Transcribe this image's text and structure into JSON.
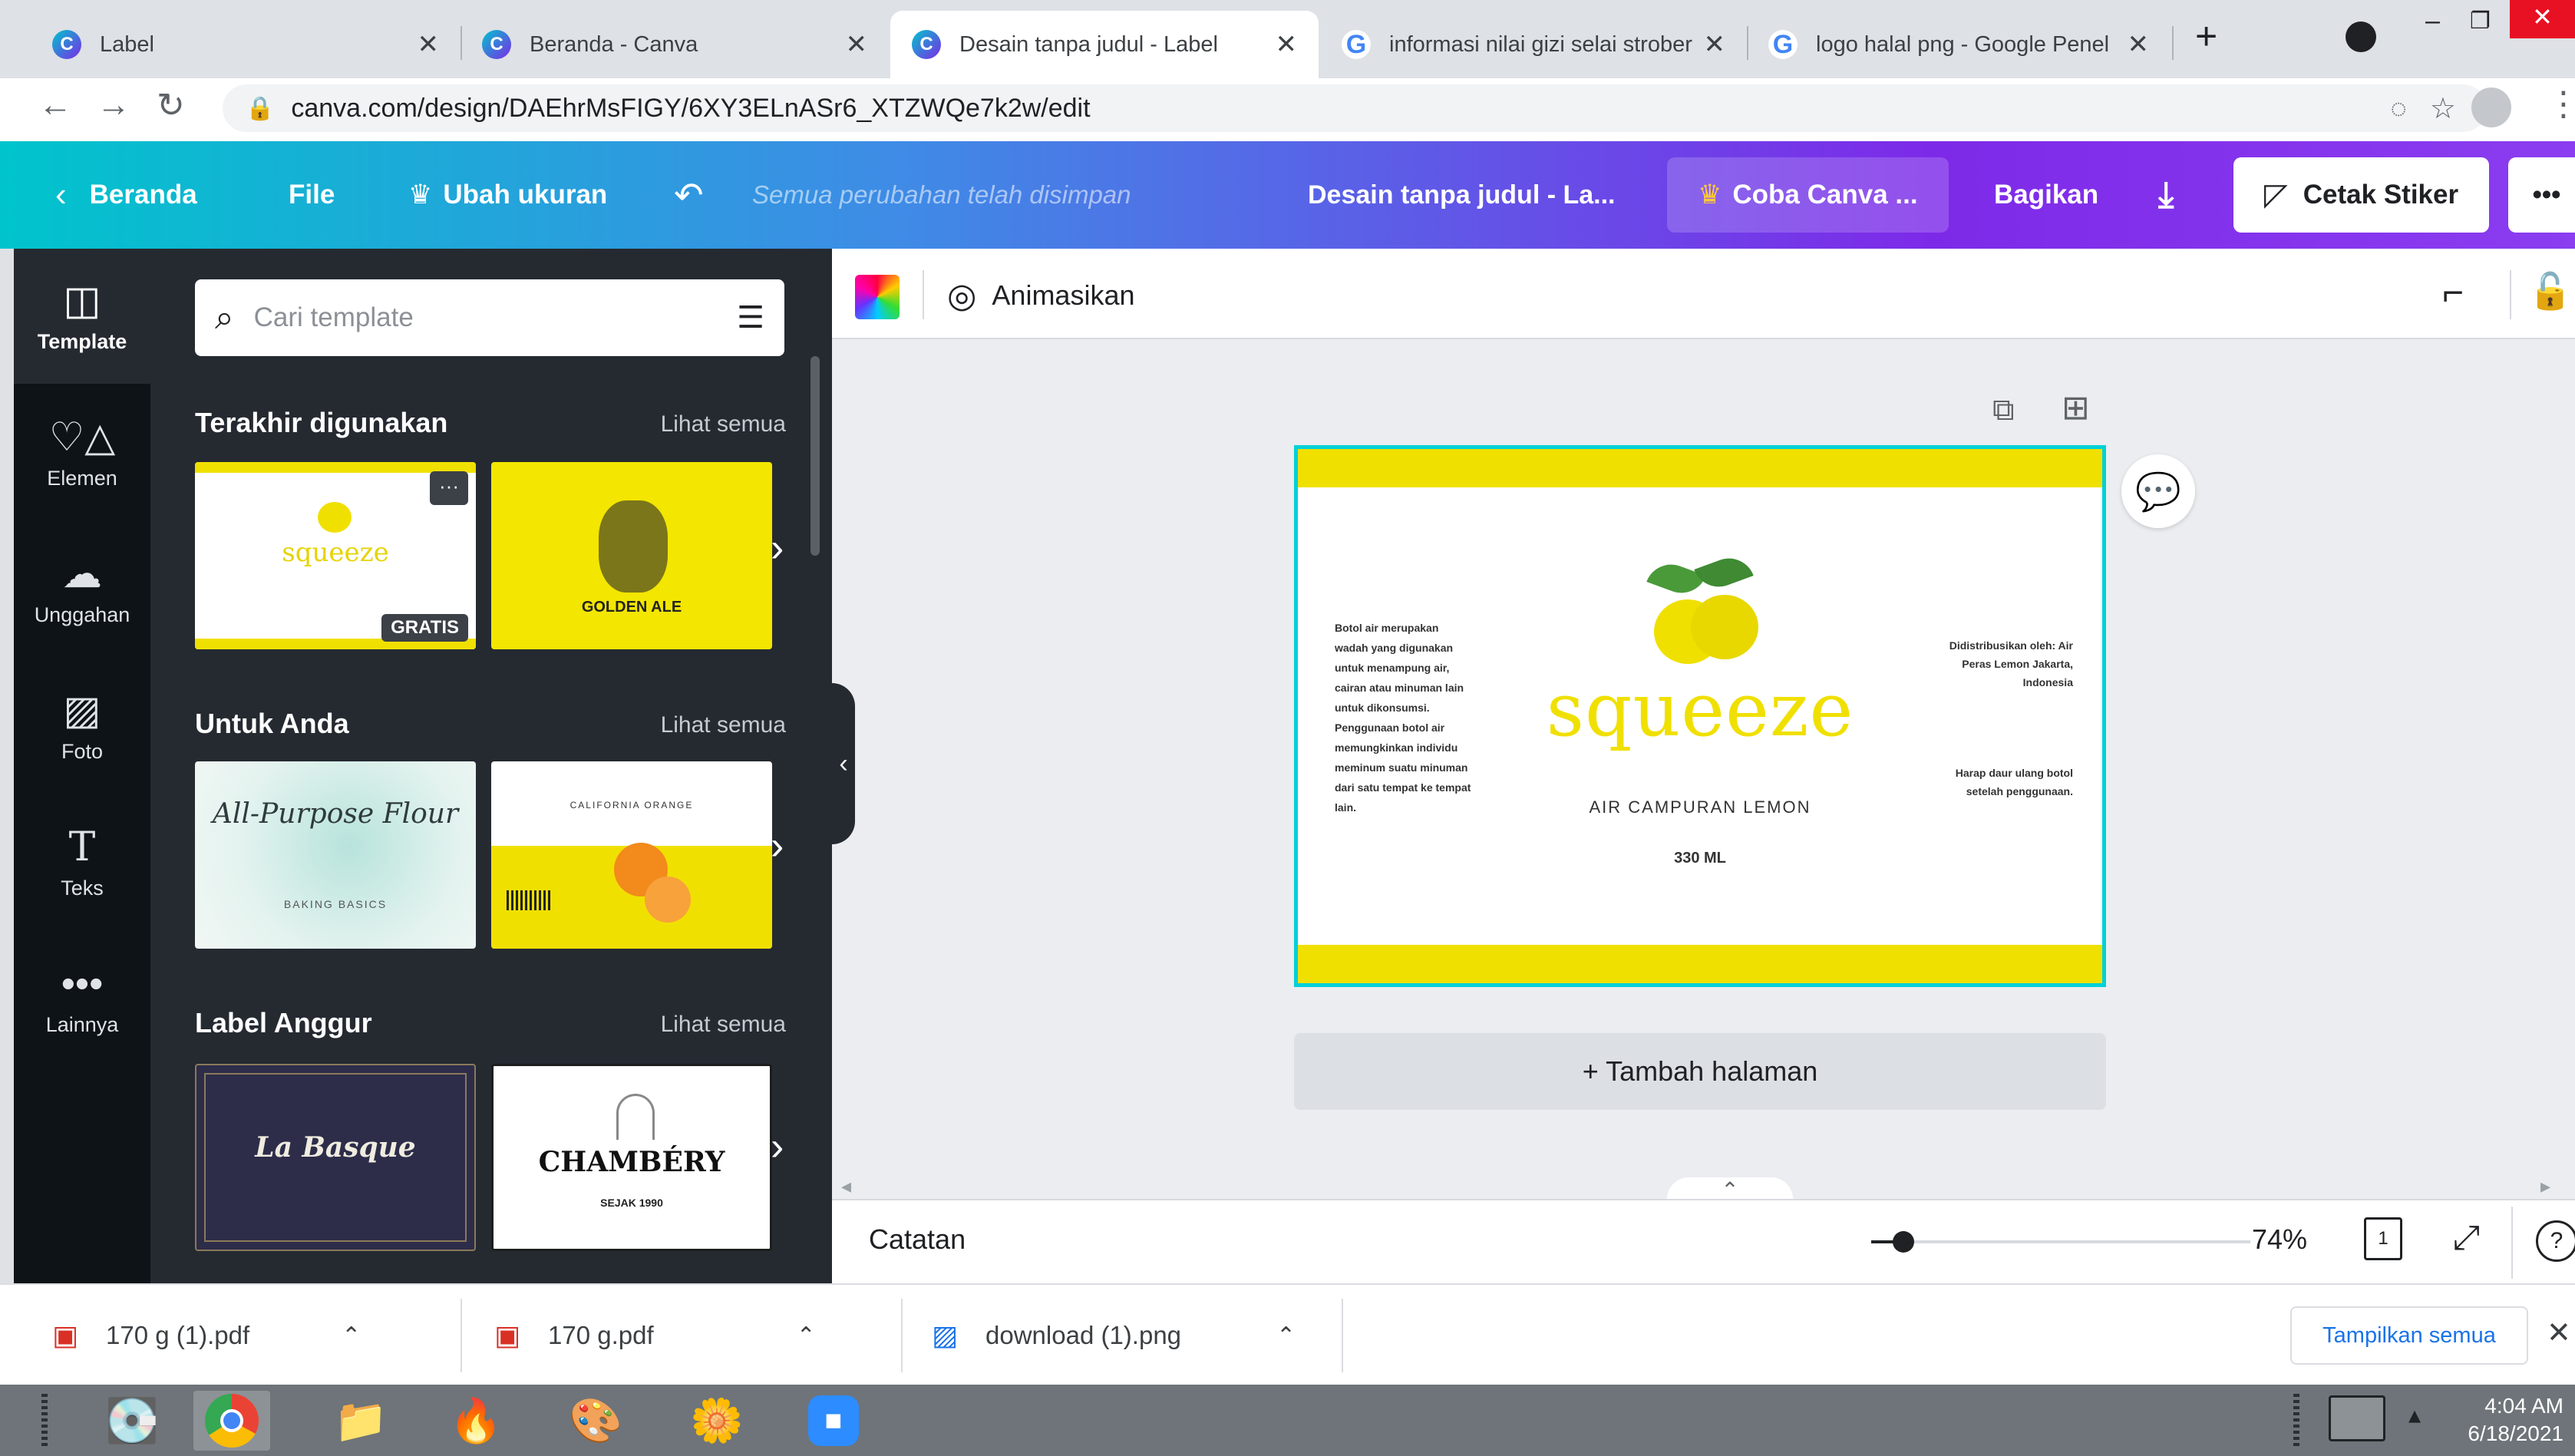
{
  "browser": {
    "tabs": [
      {
        "title": "Label",
        "icon": "canva-icon",
        "active": false
      },
      {
        "title": "Beranda - Canva",
        "icon": "canva-icon",
        "active": false
      },
      {
        "title": "Desain tanpa judul - Label",
        "icon": "canva-icon",
        "active": true
      },
      {
        "title": "informasi nilai gizi selai strober",
        "icon": "google-icon",
        "active": false
      },
      {
        "title": "logo halal png - Google Penel",
        "icon": "google-icon",
        "active": false
      }
    ],
    "close_glyph": "✕",
    "new_tab_glyph": "+",
    "url": "canva.com/design/DAEhrMsFIGY/6XY3ELnASr6_XTZWQe7k2w/edit"
  },
  "header": {
    "home_label": "Beranda",
    "file_label": "File",
    "resize_label": "Ubah ukuran",
    "saved_status": "Semua perubahan telah disimpan",
    "design_title": "Desain tanpa judul - La...",
    "try_label": "Coba Canva ...",
    "share_label": "Bagikan",
    "print_label": "Cetak Stiker",
    "more_glyph": "•••"
  },
  "rail": {
    "items": [
      {
        "label": "Template",
        "icon": "template-icon"
      },
      {
        "label": "Elemen",
        "icon": "elements-icon"
      },
      {
        "label": "Unggahan",
        "icon": "upload-icon"
      },
      {
        "label": "Foto",
        "icon": "photo-icon"
      },
      {
        "label": "Teks",
        "icon": "text-icon"
      },
      {
        "label": "Lainnya",
        "icon": "more-icon"
      }
    ]
  },
  "panel": {
    "search_placeholder": "Cari template",
    "sections": [
      {
        "title": "Terakhir digunakan",
        "link": "Lihat semua"
      },
      {
        "title": "Untuk Anda",
        "link": "Lihat semua"
      },
      {
        "title": "Label Anggur",
        "link": "Lihat semua"
      }
    ],
    "thumbs": {
      "squeeze_brand": "squeeze",
      "squeeze_badge": "GRATIS",
      "golden_title": "GOLDEN ALE",
      "flour_title": "All-Purpose Flour",
      "flour_sub": "BAKING BASICS",
      "orange_title": "CALIFORNIA ORANGE",
      "basque_title": "La Basque",
      "chambery_title": "CHAMBÉRY",
      "chambery_sub": "SEJAK 1990"
    }
  },
  "toolbar": {
    "animate_label": "Animasikan"
  },
  "design": {
    "left_text": "Botol air merupakan wadah yang digunakan untuk menampung air, cairan atau minuman lain untuk dikonsumsi. Penggunaan botol air memungkinkan individu meminum suatu minuman dari satu tempat ke tempat lain.",
    "brand": "squeeze",
    "subtitle": "AIR CAMPURAN LEMON",
    "volume": "330 ML",
    "right_top": "Didistribusikan oleh: Air Peras Lemon Jakarta, Indonesia",
    "right_bottom": "Harap daur ulang botol setelah penggunaan.",
    "accent_yellow": "#f0e000",
    "leaf_green": "#4a9a3a"
  },
  "canvas": {
    "add_page_label": "+ Tambah halaman",
    "notes_label": "Catatan",
    "zoom": "74%",
    "page_count": "1",
    "help_glyph": "?"
  },
  "downloads": {
    "items": [
      {
        "name": "170 g (1).pdf",
        "icon": "pdf-icon"
      },
      {
        "name": "170 g.pdf",
        "icon": "pdf-icon"
      },
      {
        "name": "download (1).png",
        "icon": "image-icon"
      }
    ],
    "show_all_label": "Tampilkan semua"
  },
  "taskbar": {
    "time": "4:04 AM",
    "date": "6/18/2021"
  }
}
